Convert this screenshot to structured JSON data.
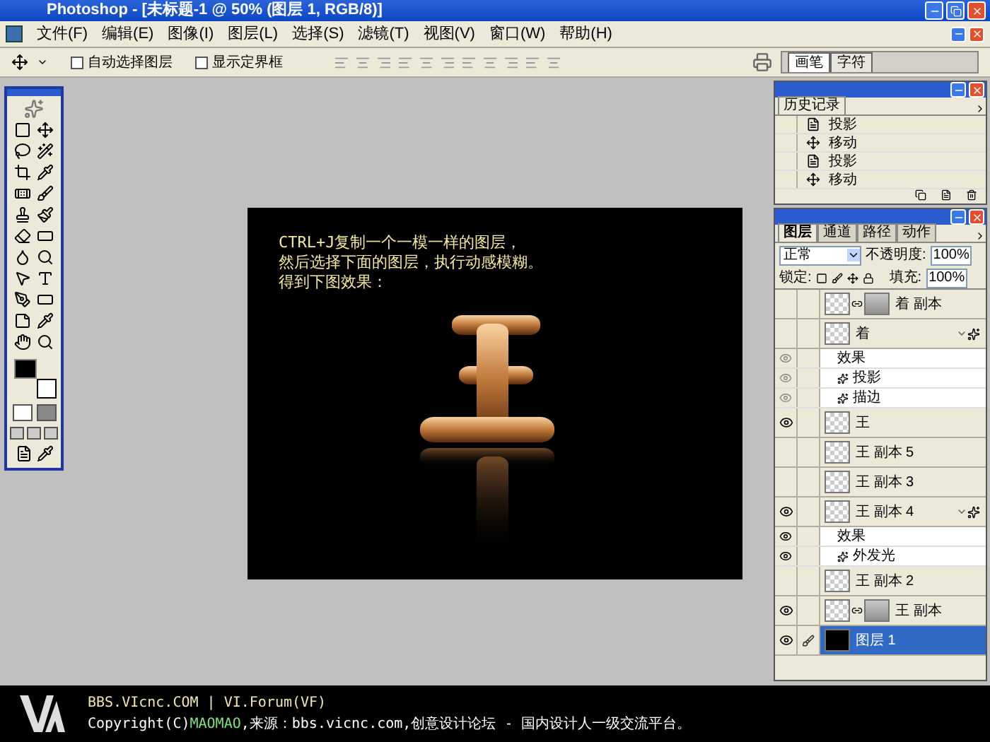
{
  "window": {
    "title": "Photoshop - [未标题-1 @ 50% (图层 1, RGB/8)]"
  },
  "menu": [
    "文件(F)",
    "编辑(E)",
    "图像(I)",
    "图层(L)",
    "选择(S)",
    "滤镜(T)",
    "视图(V)",
    "窗口(W)",
    "帮助(H)"
  ],
  "options_bar": {
    "checkboxes": [
      {
        "label": "自动选择图层",
        "checked": false
      },
      {
        "label": "显示定界框",
        "checked": false
      }
    ],
    "palette_well_tabs": [
      {
        "label": "画笔",
        "selected": true
      },
      {
        "label": "字符",
        "selected": false
      }
    ]
  },
  "canvas": {
    "lines": [
      "CTRL+J复制一个一模一样的图层，",
      "然后选择下面的图层，执行动感模糊。",
      "得到下图效果："
    ]
  },
  "history": {
    "title": "历史记录",
    "items": [
      {
        "kind": "effect",
        "label": "投影"
      },
      {
        "kind": "move",
        "label": "移动"
      },
      {
        "kind": "effect",
        "label": "投影"
      },
      {
        "kind": "move",
        "label": "移动"
      }
    ]
  },
  "layers_panel": {
    "tabs": [
      {
        "label": "图层",
        "selected": true
      },
      {
        "label": "通道",
        "selected": false
      },
      {
        "label": "路径",
        "selected": false
      },
      {
        "label": "动作",
        "selected": false
      }
    ],
    "blend_mode": "正常",
    "opacity_label": "不透明度:",
    "opacity": "100%",
    "lock_label": "锁定:",
    "fill_label": "填充:",
    "fill": "100%",
    "rows": [
      {
        "kind": "layer",
        "name": "着 副本",
        "visible": false,
        "mask": true,
        "effects": false,
        "selected": false
      },
      {
        "kind": "layer",
        "name": "着",
        "visible": false,
        "mask": false,
        "effects": true,
        "selected": false
      },
      {
        "kind": "effects",
        "name": "效果",
        "visible": true,
        "dimmed": true
      },
      {
        "kind": "effect",
        "name": "投影",
        "visible": true,
        "dimmed": true
      },
      {
        "kind": "effect",
        "name": "描边",
        "visible": true,
        "dimmed": true
      },
      {
        "kind": "layer",
        "name": "王",
        "visible": true,
        "mask": false,
        "effects": false,
        "selected": false
      },
      {
        "kind": "layer",
        "name": "王 副本 5",
        "visible": false,
        "mask": false,
        "effects": false,
        "selected": false
      },
      {
        "kind": "layer",
        "name": "王 副本 3",
        "visible": false,
        "mask": false,
        "effects": false,
        "selected": false
      },
      {
        "kind": "layer",
        "name": "王 副本 4",
        "visible": true,
        "mask": false,
        "effects": true,
        "selected": false
      },
      {
        "kind": "effects",
        "name": "效果",
        "visible": true,
        "dimmed": false
      },
      {
        "kind": "effect",
        "name": "外发光",
        "visible": true,
        "dimmed": false
      },
      {
        "kind": "layer",
        "name": "王 副本 2",
        "visible": false,
        "mask": false,
        "effects": false,
        "selected": false
      },
      {
        "kind": "layer",
        "name": "王 副本",
        "visible": true,
        "mask": true,
        "effects": false,
        "selected": false
      },
      {
        "kind": "layer",
        "name": "图层 1",
        "visible": true,
        "mask": false,
        "effects": false,
        "selected": true,
        "opaque_thumbnail": true
      }
    ]
  },
  "footer": {
    "site": "BBS.VIcnc.COM | VI.Forum(VF)",
    "copyright": {
      "before": "Copyright(C)",
      "author": "MAOMAO",
      "after": ",来源：bbs.vicnc.com,创意设计论坛 - 国内设计人一级交流平台。"
    }
  }
}
